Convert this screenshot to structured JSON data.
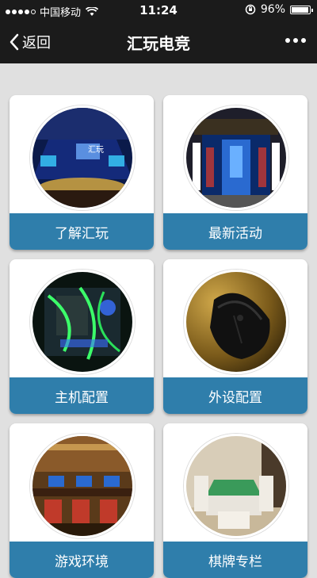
{
  "status_bar": {
    "carrier": "中国移动",
    "time": "11:24",
    "battery": "96%",
    "battery_level": 0.96
  },
  "nav": {
    "back_label": "返回",
    "title": "汇玩电竞"
  },
  "cards": [
    {
      "label": "了解汇玩",
      "icon": "venue-stage-image"
    },
    {
      "label": "最新活动",
      "icon": "storefront-image"
    },
    {
      "label": "主机配置",
      "icon": "pc-case-image"
    },
    {
      "label": "外设配置",
      "icon": "gaming-mouse-image"
    },
    {
      "label": "游戏环境",
      "icon": "game-room-image"
    },
    {
      "label": "棋牌专栏",
      "icon": "mahjong-table-image"
    }
  ],
  "colors": {
    "bar_background": "#1b1b1b",
    "page_background": "#e0e0e0",
    "card_label_background": "#2f7eab"
  }
}
